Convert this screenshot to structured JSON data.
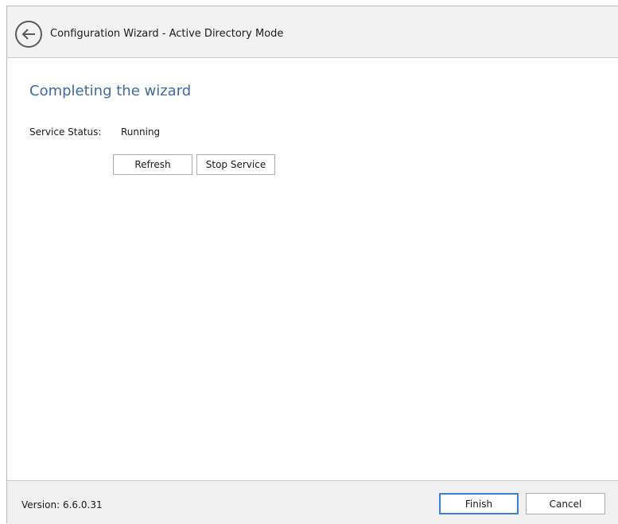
{
  "header": {
    "title": "Configuration Wizard - Active Directory Mode",
    "back_icon": "arrow-left-circle-icon"
  },
  "main": {
    "heading": "Completing the wizard",
    "service_status_label": "Service Status:",
    "service_status_value": "Running",
    "refresh_label": "Refresh",
    "stop_service_label": "Stop Service"
  },
  "footer": {
    "version": "Version: 6.6.0.31",
    "finish_label": "Finish",
    "cancel_label": "Cancel"
  },
  "colors": {
    "heading": "#3f6aa1",
    "header_bg": "#f2f2f2",
    "footer_bg": "#f0f0f0",
    "default_button_border": "#3c7fd4"
  }
}
